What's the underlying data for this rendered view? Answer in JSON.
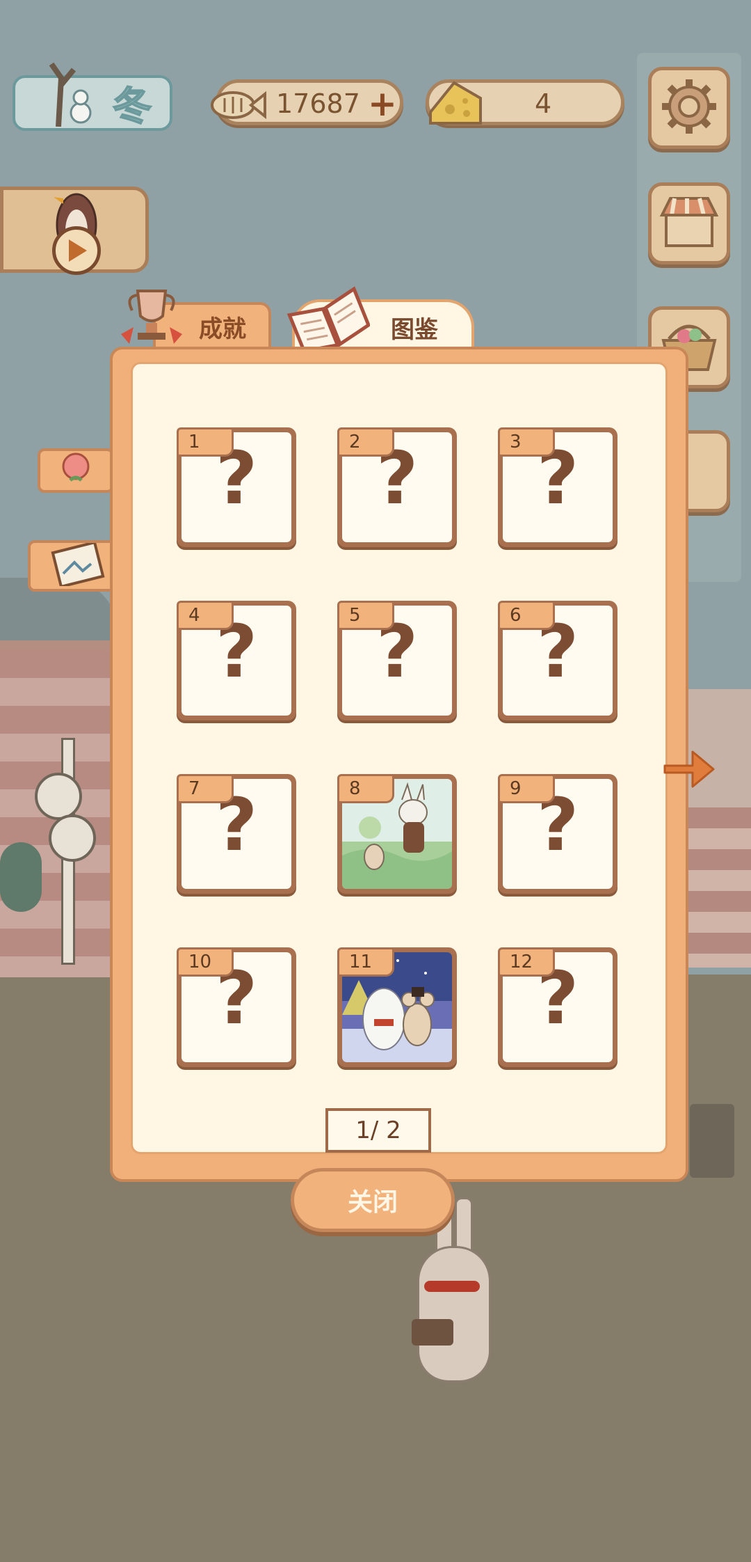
{
  "season": {
    "label": "冬"
  },
  "currency": {
    "fish_count": "17687",
    "cheese_count": "4"
  },
  "tabs": [
    {
      "label": "成就",
      "active": false
    },
    {
      "label": "图鉴",
      "active": true
    }
  ],
  "collection": {
    "cards": [
      {
        "number": "1",
        "unlocked": false
      },
      {
        "number": "2",
        "unlocked": false
      },
      {
        "number": "3",
        "unlocked": false
      },
      {
        "number": "4",
        "unlocked": false
      },
      {
        "number": "5",
        "unlocked": false
      },
      {
        "number": "6",
        "unlocked": false
      },
      {
        "number": "7",
        "unlocked": false
      },
      {
        "number": "8",
        "unlocked": true
      },
      {
        "number": "9",
        "unlocked": false
      },
      {
        "number": "10",
        "unlocked": false
      },
      {
        "number": "11",
        "unlocked": true
      },
      {
        "number": "12",
        "unlocked": false
      }
    ],
    "locked_glyph": "?",
    "pager": "1/ 2"
  },
  "close_label": "关闭",
  "colors": {
    "panel": "#f1b07a",
    "panel_inner": "#fff6e3",
    "card_border": "#a8704e",
    "accent_arrow": "#e07c3c"
  },
  "icons": [
    "settings-gear-icon",
    "shop-stall-icon",
    "basket-icon",
    "fish-icon",
    "cheese-icon",
    "plus-icon",
    "trophy-icon",
    "book-icon",
    "flower-icon",
    "photo-icon",
    "play-icon",
    "arrow-right-icon"
  ]
}
